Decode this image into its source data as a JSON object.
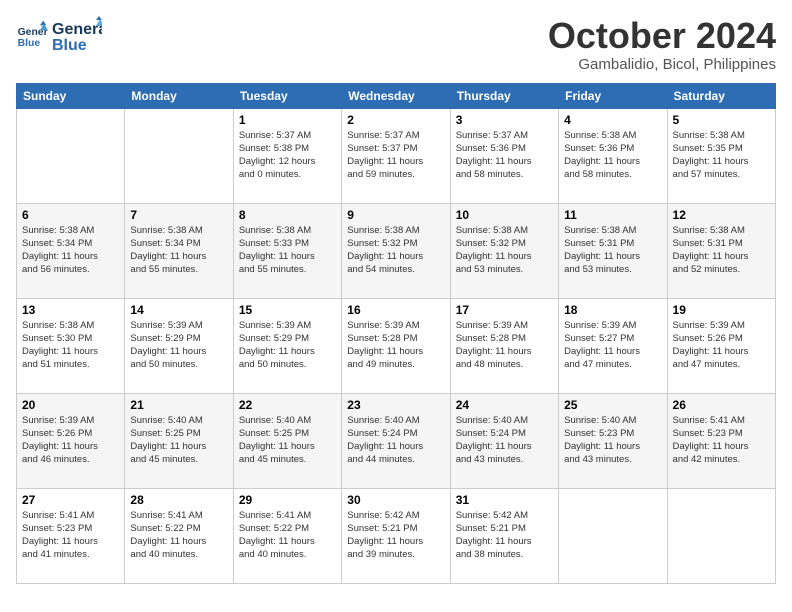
{
  "header": {
    "logo_line1": "General",
    "logo_line2": "Blue",
    "month": "October 2024",
    "location": "Gambalidio, Bicol, Philippines"
  },
  "weekdays": [
    "Sunday",
    "Monday",
    "Tuesday",
    "Wednesday",
    "Thursday",
    "Friday",
    "Saturday"
  ],
  "weeks": [
    [
      {
        "day": "",
        "info": ""
      },
      {
        "day": "",
        "info": ""
      },
      {
        "day": "1",
        "info": "Sunrise: 5:37 AM\nSunset: 5:38 PM\nDaylight: 12 hours\nand 0 minutes."
      },
      {
        "day": "2",
        "info": "Sunrise: 5:37 AM\nSunset: 5:37 PM\nDaylight: 11 hours\nand 59 minutes."
      },
      {
        "day": "3",
        "info": "Sunrise: 5:37 AM\nSunset: 5:36 PM\nDaylight: 11 hours\nand 58 minutes."
      },
      {
        "day": "4",
        "info": "Sunrise: 5:38 AM\nSunset: 5:36 PM\nDaylight: 11 hours\nand 58 minutes."
      },
      {
        "day": "5",
        "info": "Sunrise: 5:38 AM\nSunset: 5:35 PM\nDaylight: 11 hours\nand 57 minutes."
      }
    ],
    [
      {
        "day": "6",
        "info": "Sunrise: 5:38 AM\nSunset: 5:34 PM\nDaylight: 11 hours\nand 56 minutes."
      },
      {
        "day": "7",
        "info": "Sunrise: 5:38 AM\nSunset: 5:34 PM\nDaylight: 11 hours\nand 55 minutes."
      },
      {
        "day": "8",
        "info": "Sunrise: 5:38 AM\nSunset: 5:33 PM\nDaylight: 11 hours\nand 55 minutes."
      },
      {
        "day": "9",
        "info": "Sunrise: 5:38 AM\nSunset: 5:32 PM\nDaylight: 11 hours\nand 54 minutes."
      },
      {
        "day": "10",
        "info": "Sunrise: 5:38 AM\nSunset: 5:32 PM\nDaylight: 11 hours\nand 53 minutes."
      },
      {
        "day": "11",
        "info": "Sunrise: 5:38 AM\nSunset: 5:31 PM\nDaylight: 11 hours\nand 53 minutes."
      },
      {
        "day": "12",
        "info": "Sunrise: 5:38 AM\nSunset: 5:31 PM\nDaylight: 11 hours\nand 52 minutes."
      }
    ],
    [
      {
        "day": "13",
        "info": "Sunrise: 5:38 AM\nSunset: 5:30 PM\nDaylight: 11 hours\nand 51 minutes."
      },
      {
        "day": "14",
        "info": "Sunrise: 5:39 AM\nSunset: 5:29 PM\nDaylight: 11 hours\nand 50 minutes."
      },
      {
        "day": "15",
        "info": "Sunrise: 5:39 AM\nSunset: 5:29 PM\nDaylight: 11 hours\nand 50 minutes."
      },
      {
        "day": "16",
        "info": "Sunrise: 5:39 AM\nSunset: 5:28 PM\nDaylight: 11 hours\nand 49 minutes."
      },
      {
        "day": "17",
        "info": "Sunrise: 5:39 AM\nSunset: 5:28 PM\nDaylight: 11 hours\nand 48 minutes."
      },
      {
        "day": "18",
        "info": "Sunrise: 5:39 AM\nSunset: 5:27 PM\nDaylight: 11 hours\nand 47 minutes."
      },
      {
        "day": "19",
        "info": "Sunrise: 5:39 AM\nSunset: 5:26 PM\nDaylight: 11 hours\nand 47 minutes."
      }
    ],
    [
      {
        "day": "20",
        "info": "Sunrise: 5:39 AM\nSunset: 5:26 PM\nDaylight: 11 hours\nand 46 minutes."
      },
      {
        "day": "21",
        "info": "Sunrise: 5:40 AM\nSunset: 5:25 PM\nDaylight: 11 hours\nand 45 minutes."
      },
      {
        "day": "22",
        "info": "Sunrise: 5:40 AM\nSunset: 5:25 PM\nDaylight: 11 hours\nand 45 minutes."
      },
      {
        "day": "23",
        "info": "Sunrise: 5:40 AM\nSunset: 5:24 PM\nDaylight: 11 hours\nand 44 minutes."
      },
      {
        "day": "24",
        "info": "Sunrise: 5:40 AM\nSunset: 5:24 PM\nDaylight: 11 hours\nand 43 minutes."
      },
      {
        "day": "25",
        "info": "Sunrise: 5:40 AM\nSunset: 5:23 PM\nDaylight: 11 hours\nand 43 minutes."
      },
      {
        "day": "26",
        "info": "Sunrise: 5:41 AM\nSunset: 5:23 PM\nDaylight: 11 hours\nand 42 minutes."
      }
    ],
    [
      {
        "day": "27",
        "info": "Sunrise: 5:41 AM\nSunset: 5:23 PM\nDaylight: 11 hours\nand 41 minutes."
      },
      {
        "day": "28",
        "info": "Sunrise: 5:41 AM\nSunset: 5:22 PM\nDaylight: 11 hours\nand 40 minutes."
      },
      {
        "day": "29",
        "info": "Sunrise: 5:41 AM\nSunset: 5:22 PM\nDaylight: 11 hours\nand 40 minutes."
      },
      {
        "day": "30",
        "info": "Sunrise: 5:42 AM\nSunset: 5:21 PM\nDaylight: 11 hours\nand 39 minutes."
      },
      {
        "day": "31",
        "info": "Sunrise: 5:42 AM\nSunset: 5:21 PM\nDaylight: 11 hours\nand 38 minutes."
      },
      {
        "day": "",
        "info": ""
      },
      {
        "day": "",
        "info": ""
      }
    ]
  ]
}
